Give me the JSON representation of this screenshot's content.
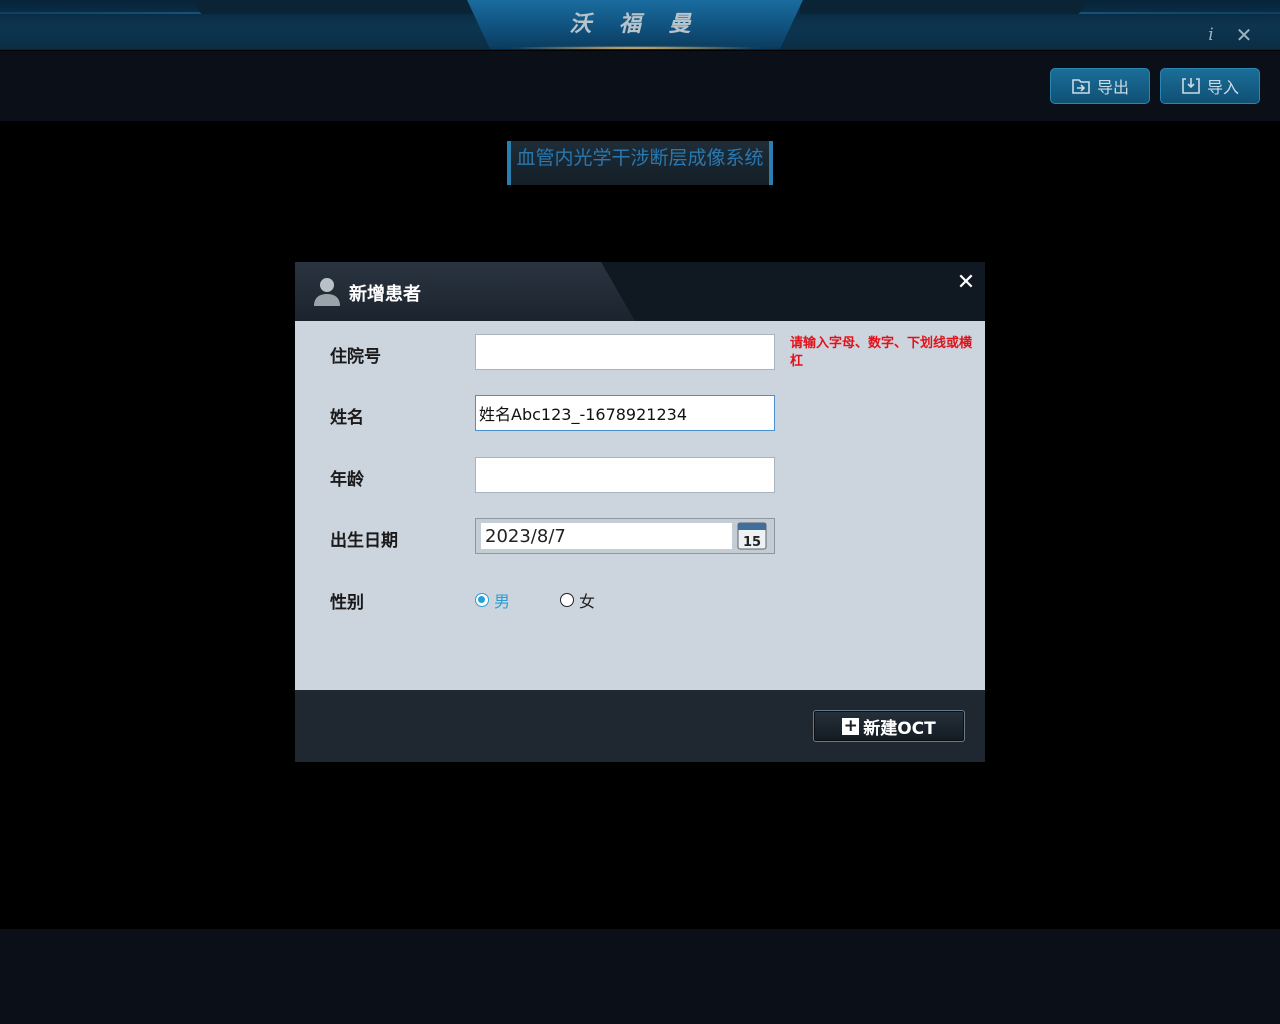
{
  "app": {
    "brand": "沃 福 曼",
    "system_title": "血管内光学干涉断层成像系统"
  },
  "toolbar": {
    "export_label": "导出",
    "import_label": "导入"
  },
  "dialog": {
    "title": "新增患者",
    "fields": {
      "admission_no": {
        "label": "住院号",
        "value": ""
      },
      "name": {
        "label": "姓名",
        "value": "姓名Abc123_-1678921234"
      },
      "age": {
        "label": "年龄",
        "value": ""
      },
      "birth_date": {
        "label": "出生日期",
        "value": "2023/8/7"
      },
      "gender": {
        "label": "性别",
        "options": [
          "男",
          "女"
        ],
        "selected": "男"
      }
    },
    "error_message": "请输入字母、数字、下划线或横杠",
    "calendar_day": "15",
    "new_oct_label": "新建OCT"
  },
  "colors": {
    "accent": "#2a9fd6",
    "error": "#e3121a",
    "dialog_body": "#ccd4de"
  },
  "icons": [
    "info-icon",
    "close-icon",
    "folder-export-icon",
    "import-icon",
    "user-icon",
    "calendar-icon",
    "plus-icon"
  ]
}
